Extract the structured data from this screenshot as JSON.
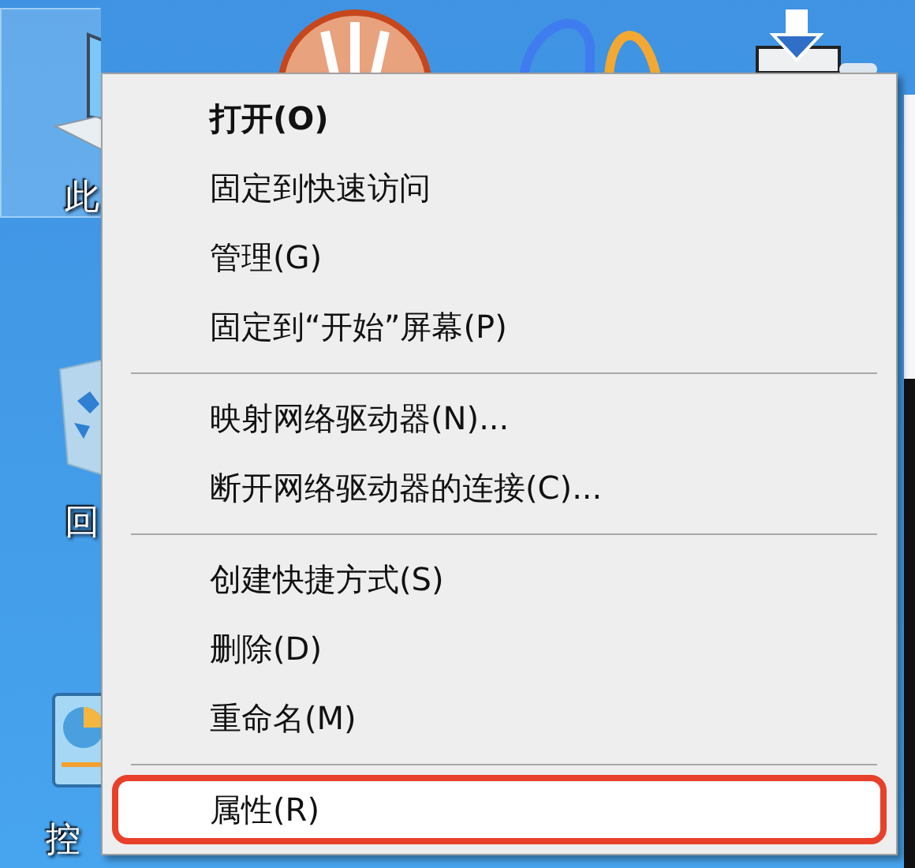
{
  "desktop_icons": [
    {
      "label": "此",
      "selected": true
    },
    {
      "label": "回",
      "selected": false
    },
    {
      "label": "控",
      "selected": false
    }
  ],
  "context_menu": {
    "items": [
      {
        "kind": "item",
        "label": "打开(O)",
        "bold": true,
        "selected": false,
        "outlined": false
      },
      {
        "kind": "item",
        "label": "固定到快速访问",
        "bold": false,
        "selected": false,
        "outlined": false
      },
      {
        "kind": "item",
        "label": "管理(G)",
        "bold": false,
        "selected": false,
        "outlined": false
      },
      {
        "kind": "item",
        "label": "固定到“开始”屏幕(P)",
        "bold": false,
        "selected": false,
        "outlined": false
      },
      {
        "kind": "separator"
      },
      {
        "kind": "item",
        "label": "映射网络驱动器(N)...",
        "bold": false,
        "selected": false,
        "outlined": false
      },
      {
        "kind": "item",
        "label": "断开网络驱动器的连接(C)...",
        "bold": false,
        "selected": false,
        "outlined": false
      },
      {
        "kind": "separator"
      },
      {
        "kind": "item",
        "label": "创建快捷方式(S)",
        "bold": false,
        "selected": false,
        "outlined": false
      },
      {
        "kind": "item",
        "label": "删除(D)",
        "bold": false,
        "selected": false,
        "outlined": false
      },
      {
        "kind": "item",
        "label": "重命名(M)",
        "bold": false,
        "selected": false,
        "outlined": false
      },
      {
        "kind": "separator"
      },
      {
        "kind": "item",
        "label": "属性(R)",
        "bold": false,
        "selected": true,
        "outlined": true
      }
    ]
  }
}
